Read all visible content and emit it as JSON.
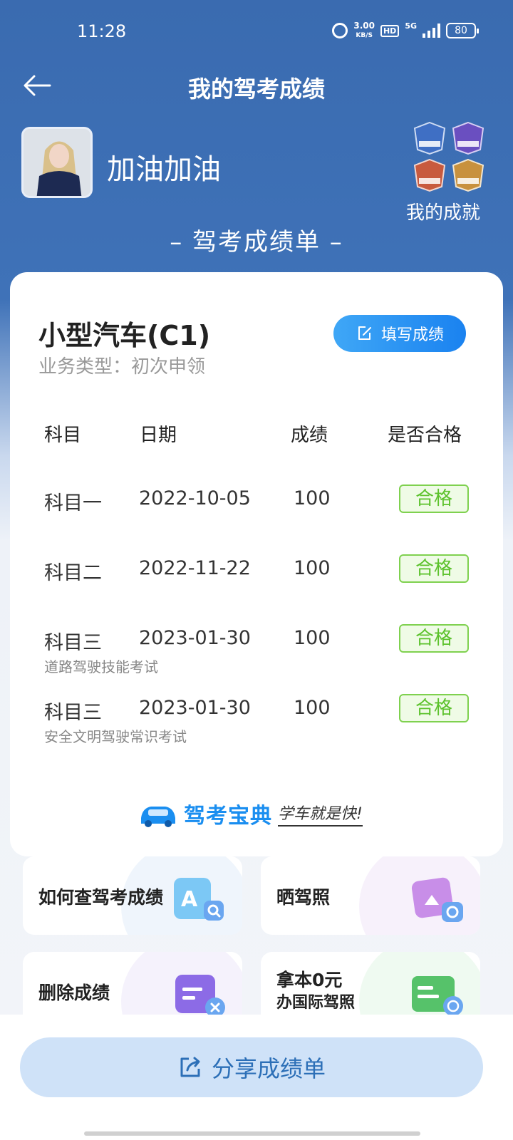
{
  "status_bar": {
    "time": "11:28",
    "net_speed_value": "3.00",
    "net_speed_unit": "KB/S",
    "hd": "HD",
    "network": "5G",
    "battery": "80"
  },
  "nav": {
    "title": "我的驾考成绩",
    "back_icon": "arrow-left-icon"
  },
  "profile": {
    "name": "加油加油",
    "achievement_label": "我的成就"
  },
  "sheet_title": "– 驾考成绩单 –",
  "card": {
    "car_type": "小型汽车(C1)",
    "business_type": "业务类型：初次申领",
    "fill_button": "填写成绩",
    "table": {
      "headers": [
        "科目",
        "日期",
        "成绩",
        "是否合格"
      ],
      "rows": [
        {
          "subject": "科目一",
          "date": "2022-10-05",
          "score": "100",
          "status": "合格",
          "note": ""
        },
        {
          "subject": "科目二",
          "date": "2022-11-22",
          "score": "100",
          "status": "合格",
          "note": ""
        },
        {
          "subject": "科目三",
          "date": "2023-01-30",
          "score": "100",
          "status": "合格",
          "note": "道路驾驶技能考试"
        },
        {
          "subject": "科目三",
          "date": "2023-01-30",
          "score": "100",
          "status": "合格",
          "note": "安全文明驾驶常识考试"
        }
      ]
    },
    "brand": {
      "name": "驾考宝典",
      "slogan": "学车就是快!"
    }
  },
  "tiles": [
    {
      "label": "如何查驾考成绩",
      "icon": "search-doc-icon"
    },
    {
      "label": "晒驾照",
      "icon": "photo-camera-icon"
    },
    {
      "label": "删除成绩",
      "icon": "delete-record-icon"
    },
    {
      "label": "拿本0元",
      "label2": "办国际驾照",
      "icon": "id-card-globe-icon"
    }
  ],
  "share_button": "分享成绩单",
  "colors": {
    "primary_blue": "#3a6bb0",
    "pass_green": "#5cc22c",
    "button_blue": "#1a82f0"
  }
}
